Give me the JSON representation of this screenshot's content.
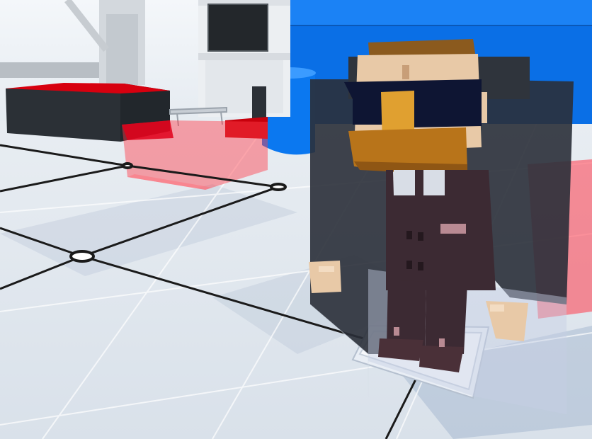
{
  "scene": {
    "type": "3d-voxel-game-viewport",
    "palette": {
      "sky": "#eef3f8",
      "floor": "#dfe6ee",
      "floor_shade": "#c9d3df",
      "grid_line": "#1a1a1a",
      "sofa_dark": "#2b3036",
      "sofa_red": "#d7000f",
      "ghost_red": "#ff3b4a",
      "blue_wall": "#0a6fe6",
      "blue_tub": "#0b78f0",
      "tower_white": "#eceff2",
      "tv_black": "#23272b",
      "pipe_gray": "#b8bec4",
      "skin": "#e8c9a7",
      "hair": "#8b5a1e",
      "beard": "#b8741a",
      "nose": "#e0a030",
      "glasses": "#0e1533",
      "suit": "#3c2a33",
      "coat": "#2a2f38",
      "shirt": "#d8dde6",
      "base_plate": "#e9eef5"
    },
    "objects": [
      {
        "name": "pipe",
        "icon": "pipe-shape"
      },
      {
        "name": "tower-with-tv",
        "icon": "tv-shape"
      },
      {
        "name": "blue-wall",
        "icon": "wall-shape"
      },
      {
        "name": "blue-tub",
        "icon": "cylinder-shape"
      },
      {
        "name": "left-sofa",
        "icon": "sofa-shape"
      },
      {
        "name": "ghost-red-block",
        "icon": "cube-shape"
      },
      {
        "name": "side-table",
        "icon": "table-shape"
      },
      {
        "name": "voxel-character",
        "icon": "person-shape"
      },
      {
        "name": "character-base-plate",
        "icon": "plate-shape"
      },
      {
        "name": "grid-node",
        "icon": "ring-shape"
      }
    ]
  }
}
